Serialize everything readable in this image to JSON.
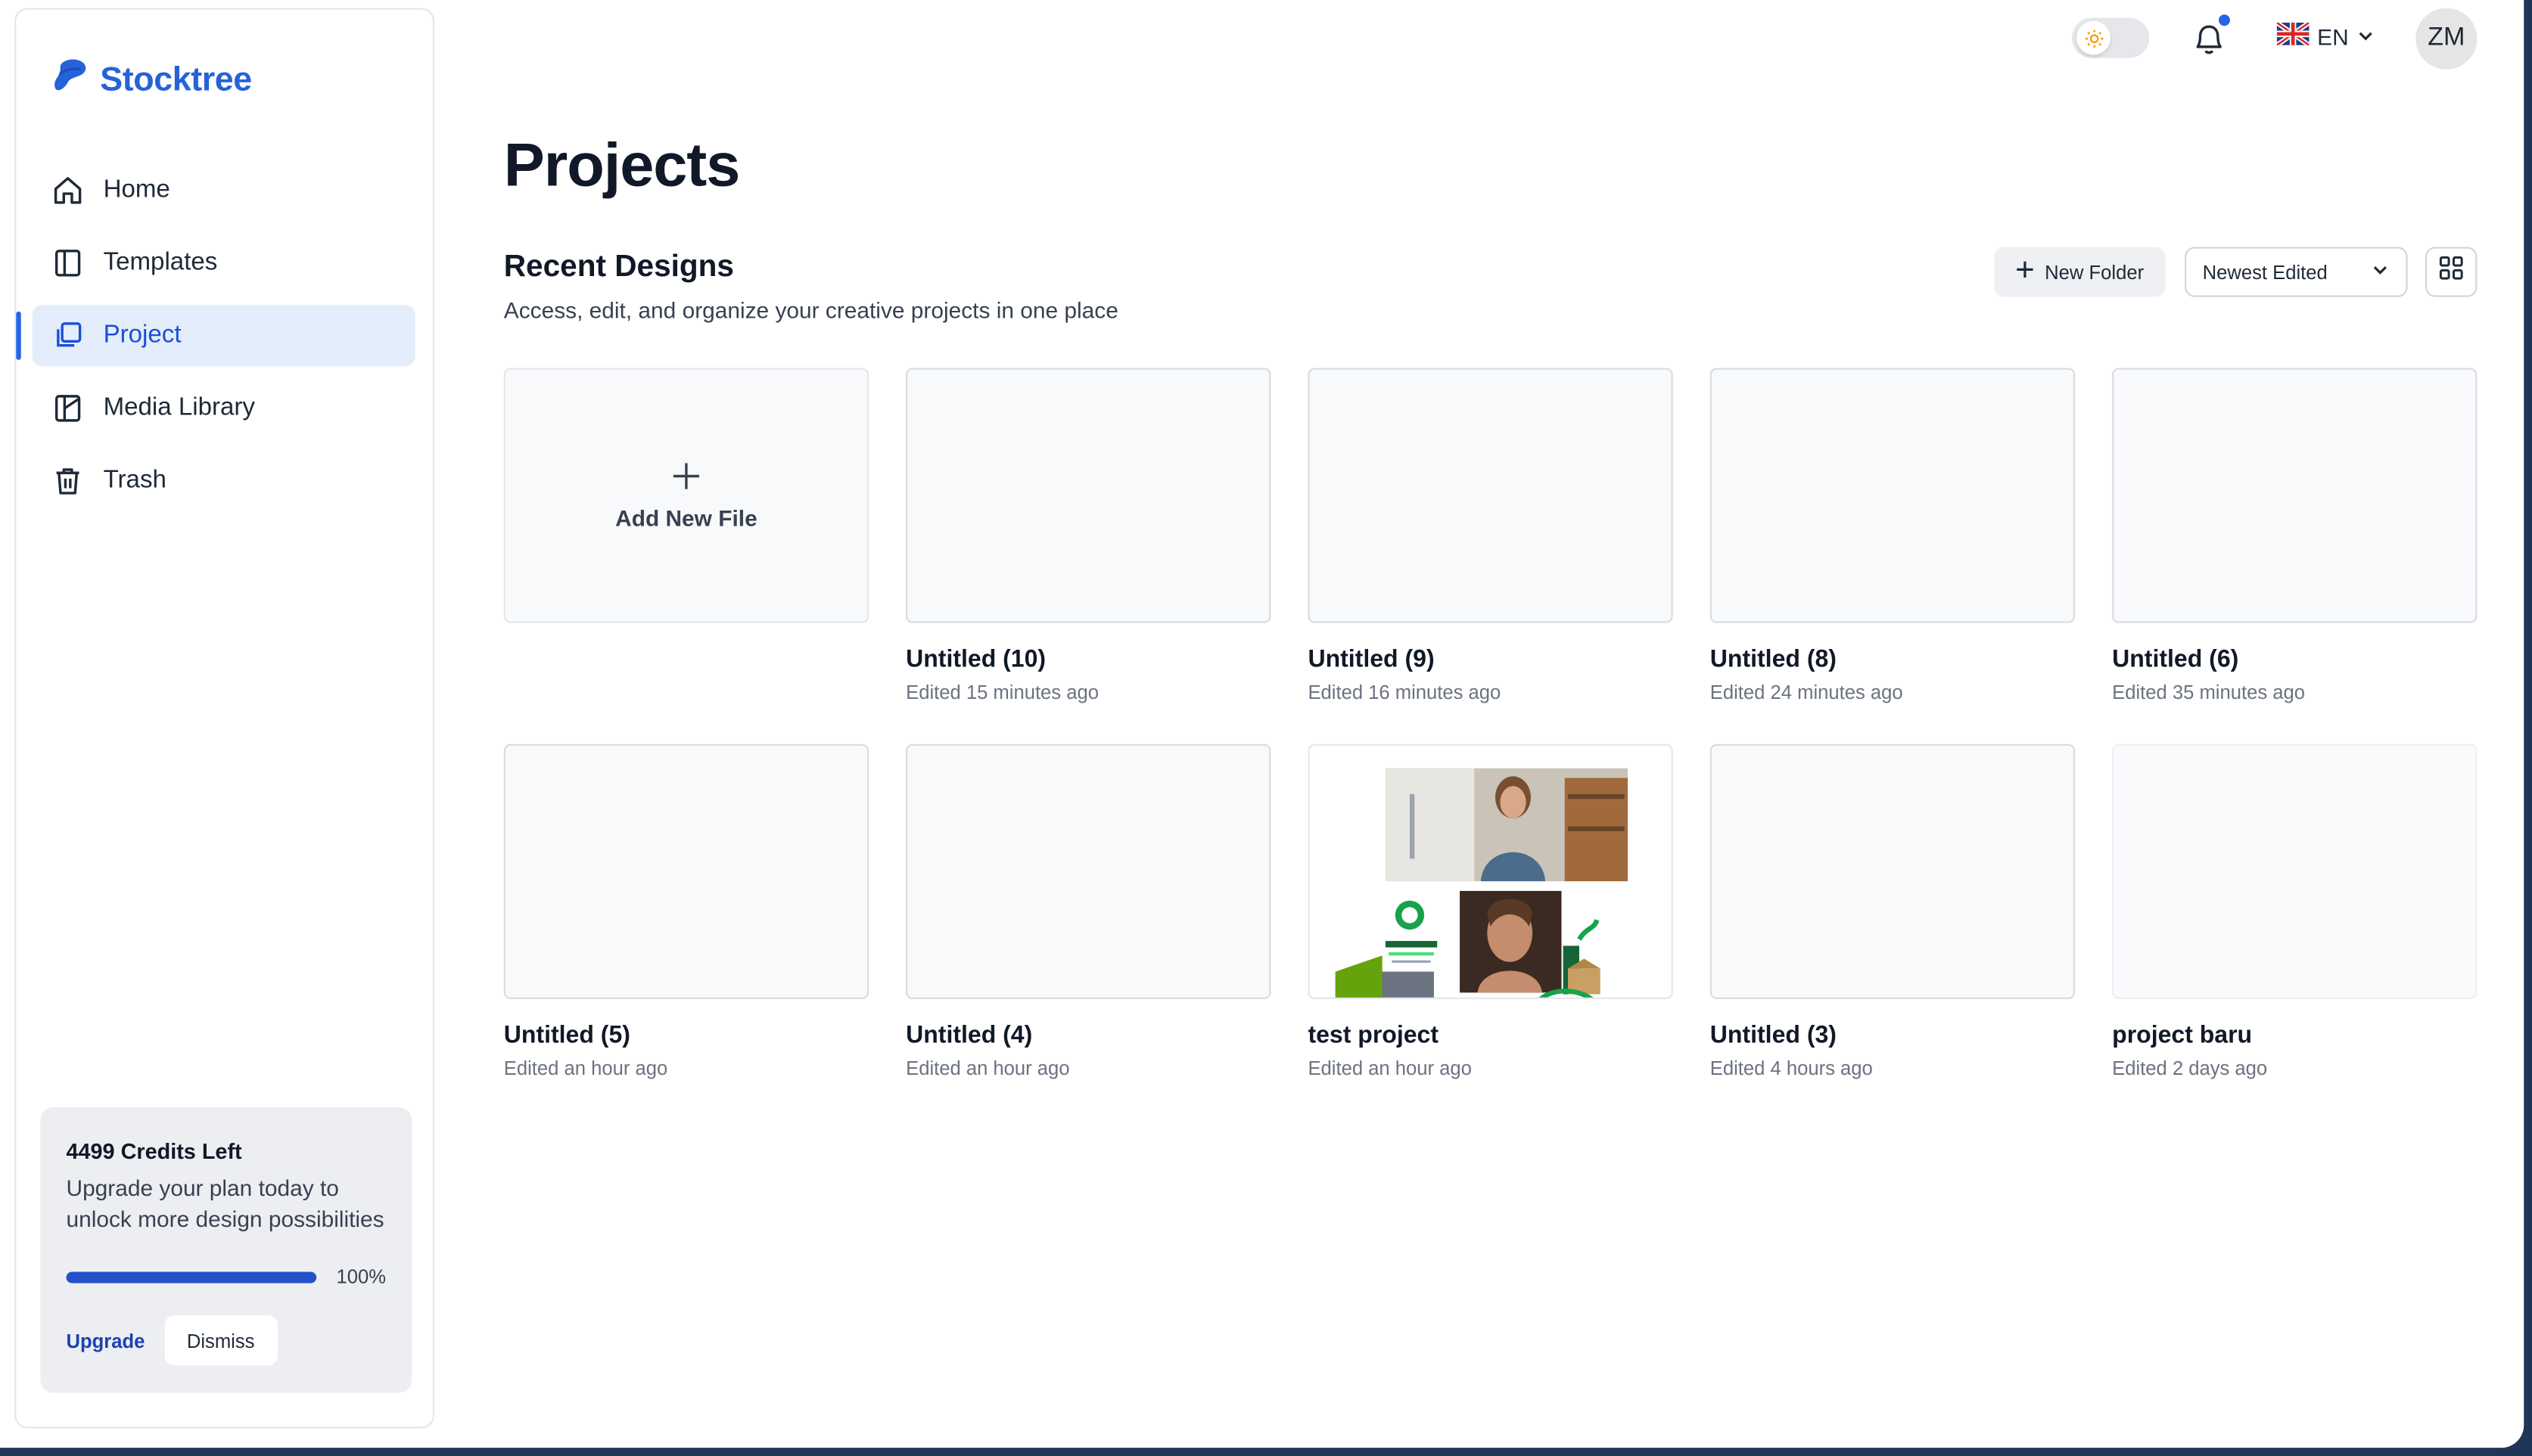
{
  "app": {
    "brand": "Stocktree"
  },
  "sidebar": {
    "items": [
      {
        "label": "Home",
        "icon": "home-icon",
        "active": false
      },
      {
        "label": "Templates",
        "icon": "templates-icon",
        "active": false
      },
      {
        "label": "Project",
        "icon": "project-icon",
        "active": true
      },
      {
        "label": "Media Library",
        "icon": "media-library-icon",
        "active": false
      },
      {
        "label": "Trash",
        "icon": "trash-icon",
        "active": false
      }
    ],
    "credits": {
      "title": "4499 Credits Left",
      "description": "Upgrade your plan today to unlock more design possibilities",
      "progress_percent": 100,
      "progress_label": "100%",
      "upgrade_label": "Upgrade",
      "dismiss_label": "Dismiss"
    }
  },
  "topbar": {
    "theme_toggle": "light",
    "language": "EN",
    "avatar_initials": "ZM",
    "notification_dot": true
  },
  "main": {
    "title": "Projects",
    "section_title": "Recent Designs",
    "section_subtitle": "Access, edit, and organize your creative projects in one place",
    "new_folder_label": "New Folder",
    "sort_value": "Newest Edited",
    "add_new_label": "Add New File",
    "projects": [
      {
        "name": "Untitled (10)",
        "edited": "Edited 15 minutes ago"
      },
      {
        "name": "Untitled (9)",
        "edited": "Edited 16 minutes ago"
      },
      {
        "name": "Untitled (8)",
        "edited": "Edited 24 minutes ago"
      },
      {
        "name": "Untitled (6)",
        "edited": "Edited 35 minutes ago"
      },
      {
        "name": "Untitled (5)",
        "edited": "Edited an hour ago"
      },
      {
        "name": "Untitled (4)",
        "edited": "Edited an hour ago"
      },
      {
        "name": "test project",
        "edited": "Edited an hour ago"
      },
      {
        "name": "Untitled (3)",
        "edited": "Edited 4 hours ago"
      },
      {
        "name": "project baru",
        "edited": "Edited 2 days ago"
      }
    ]
  },
  "colors": {
    "accent": "#2563eb",
    "brand": "#2563d9",
    "active_bg": "#e3edfb",
    "frame": "#1f3658"
  }
}
